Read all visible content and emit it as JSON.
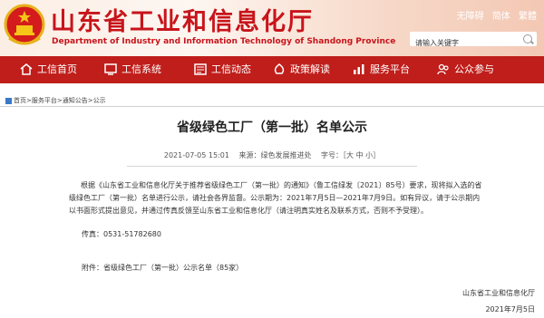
{
  "header": {
    "title": "山东省工业和信息化厅",
    "subtitle": "Department of Industry and Information Technology of Shandong Province",
    "top_links": [
      "无障碍",
      "简体",
      "繁體"
    ],
    "search_placeholder": "请输入关键字"
  },
  "nav": {
    "items": [
      {
        "label": "工信首页",
        "icon": "home-icon"
      },
      {
        "label": "工信系统",
        "icon": "system-icon"
      },
      {
        "label": "工信动态",
        "icon": "news-icon"
      },
      {
        "label": "政策解读",
        "icon": "policy-icon"
      },
      {
        "label": "服务平台",
        "icon": "service-icon"
      },
      {
        "label": "公众参与",
        "icon": "participation-icon"
      }
    ]
  },
  "breadcrumb": "首页>服务平台>通知公告>公示",
  "article": {
    "title": "省级绿色工厂（第一批）名单公示",
    "date": "2021-07-05 15:01",
    "source": "来源：绿色发展推进处",
    "font_size": "字号：［大 中 小］",
    "paragraph1": "根据《山东省工业和信息化厅关于推荐省级绿色工厂（第一批）的通知》（鲁工信绿发〔2021〕85号）要求，现将拟入选的省级绿色工厂（第一批）名单进行公示，请社会各界监督。公示期为：2021年7月5日—2021年7月9日。如有异议，请于公示期内以书面形式提出意见，并通过传真反馈至山东省工业和信息化厅（请注明真实姓名及联系方式，否则不予受理）。",
    "tel": "传真：0531-51782680",
    "attachment": "附件：省级绿色工厂（第一批）公示名单（85家）",
    "signature": "山东省工业和信息化厅",
    "sign_date": "2021年7月5日"
  }
}
